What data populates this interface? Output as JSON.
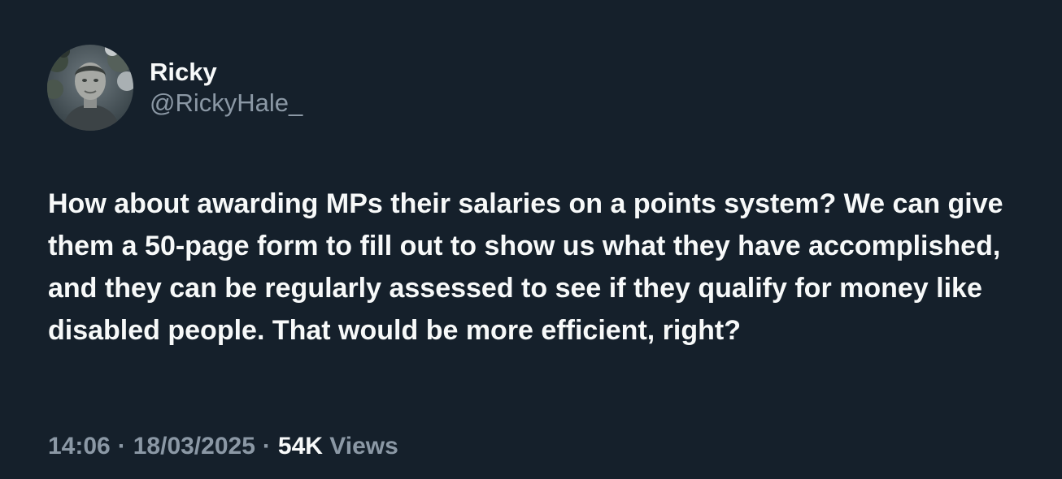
{
  "tweet": {
    "author": {
      "display_name": "Ricky",
      "handle": "@RickyHale_"
    },
    "text": "How about awarding MPs their salaries on a points system? We can give them a 50-page form to fill out to show us what they have accomplished, and they can be regularly assessed to see if they qualify for money like disabled people. That would be more efficient, right?",
    "meta": {
      "time": "14:06",
      "separator": "·",
      "date": "18/03/2025",
      "views_count": "54K",
      "views_label": "Views"
    }
  },
  "colors": {
    "background": "#15202b",
    "primary_text": "#f7f9f9",
    "secondary_text": "#8b98a5"
  }
}
